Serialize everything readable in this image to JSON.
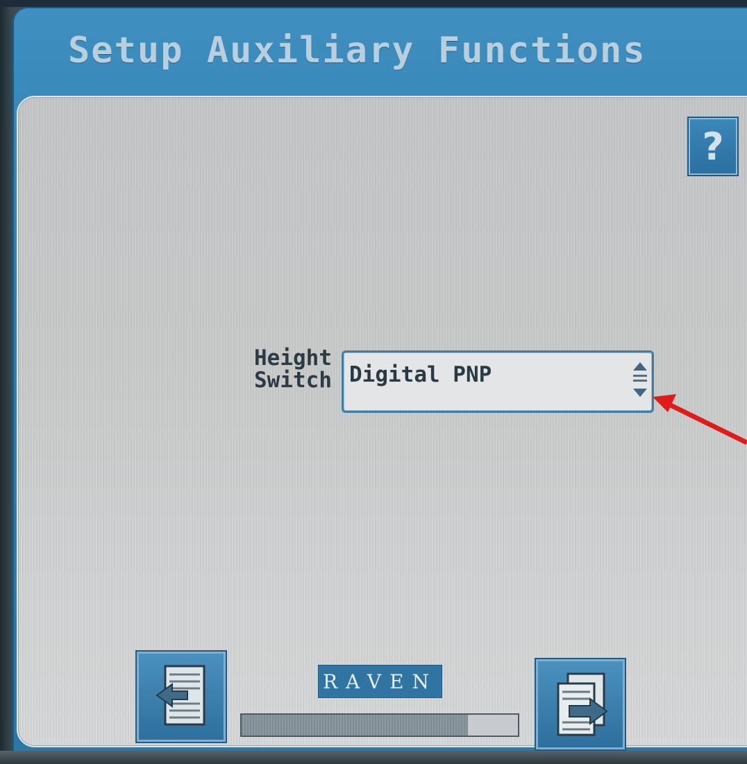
{
  "window": {
    "title": "Setup Auxiliary Functions"
  },
  "help": {
    "label": "?"
  },
  "field": {
    "label_line1": "Height",
    "label_line2": "Switch",
    "value": "Digital PNP"
  },
  "brand": {
    "text": "RAVEN"
  },
  "progress": {
    "fraction": 0.82
  },
  "icons": {
    "help": "question-icon",
    "spinner": "spinner-updown-icon",
    "back": "page-back-icon",
    "next": "page-next-icon"
  },
  "colors": {
    "frame": "#2e7cae",
    "title_text": "#b9cfdd",
    "panel": "#c8caca",
    "annotation_arrow": "#e01b1b"
  }
}
